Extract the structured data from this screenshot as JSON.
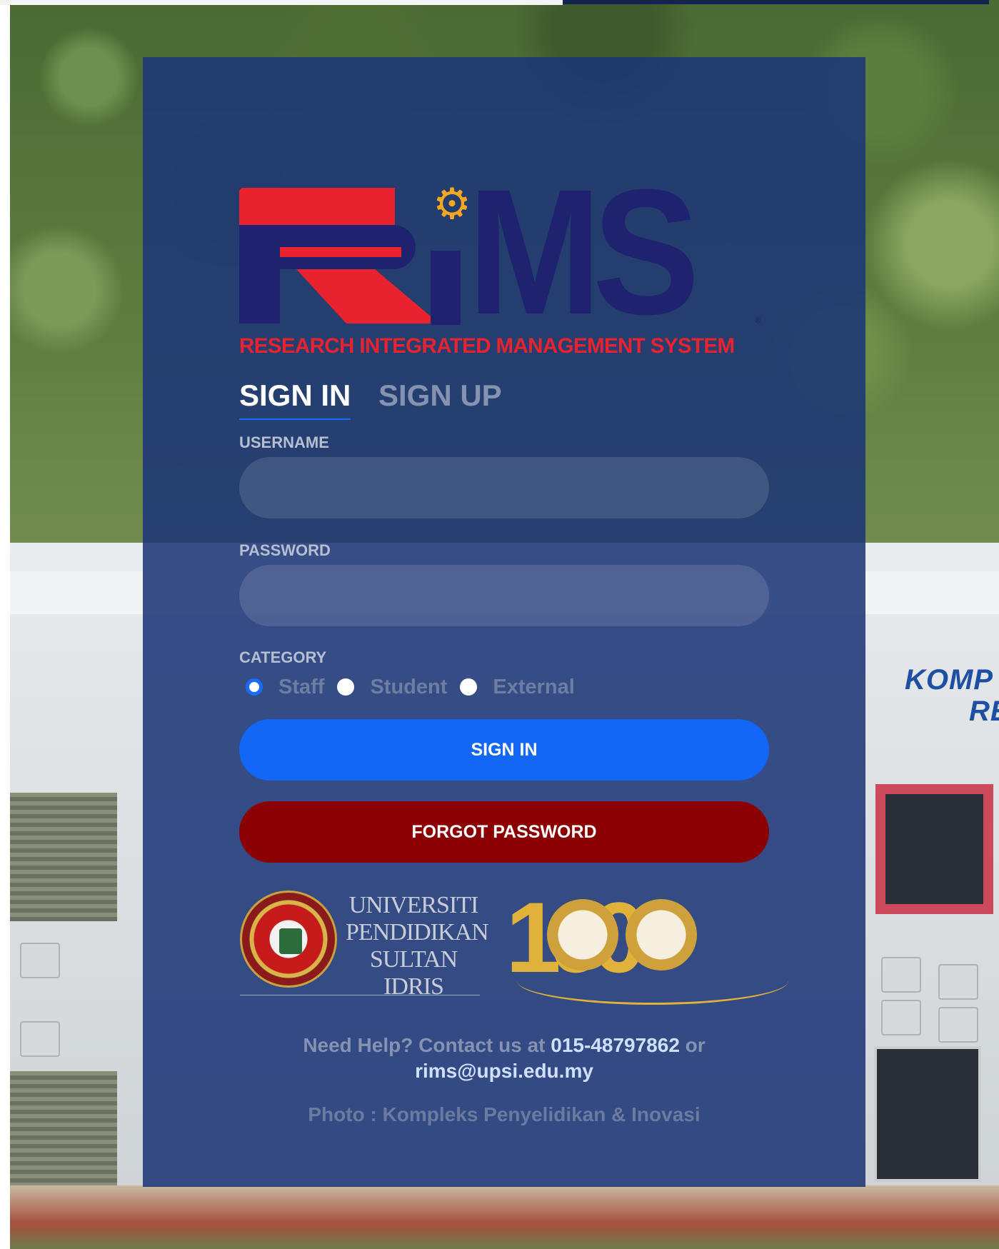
{
  "logo": {
    "letters_ms": "MS",
    "registered": "®",
    "tagline": "RESEARCH INTEGRATED MANAGEMENT SYSTEM"
  },
  "tabs": [
    {
      "label": "SIGN IN",
      "active": true
    },
    {
      "label": "SIGN UP",
      "active": false
    }
  ],
  "form": {
    "username_label": "USERNAME",
    "username_value": "",
    "password_label": "PASSWORD",
    "password_value": "",
    "category_label": "CATEGORY",
    "categories": [
      {
        "label": "Staff",
        "selected": true
      },
      {
        "label": "Student",
        "selected": false
      },
      {
        "label": "External",
        "selected": false
      }
    ]
  },
  "buttons": {
    "sign_in": "SIGN IN",
    "forgot_password": "FORGOT PASSWORD"
  },
  "partners": {
    "university_name_lines": [
      "UNIVERSITI",
      "PENDIDIKAN",
      "SULTAN IDRIS"
    ],
    "anniversary": "100"
  },
  "help": {
    "prefix": "Need Help? Contact us at",
    "phone": "015-48797862",
    "connector": "or",
    "email": "rims@upsi.edu.my"
  },
  "photo_credit": "Photo : Kompleks Penyelidikan & Inovasi",
  "colors": {
    "panel": "#1b3576",
    "primary_button": "#1466f5",
    "danger_button": "#8b0000",
    "logo_red": "#e8232f",
    "logo_navy": "#1f226e",
    "gear_orange": "#f5a623"
  }
}
